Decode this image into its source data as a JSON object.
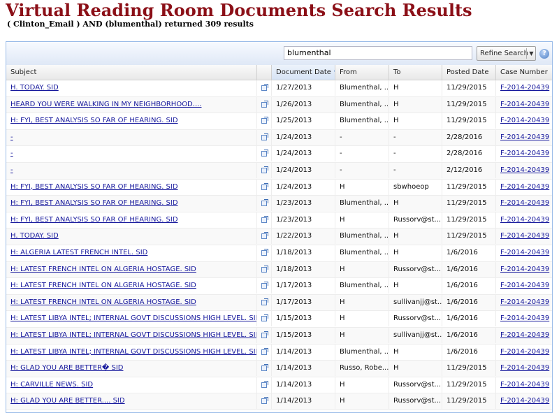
{
  "header": {
    "title": "Virtual Reading Room Documents Search Results",
    "summary": "( Clinton_Email ) AND (blumenthal) returned 309 results"
  },
  "toolbar": {
    "search_value": "blumenthal",
    "refine_label": "Refine Search",
    "dropdown_glyph": "▼",
    "help_glyph": "?"
  },
  "columns": {
    "subject": "Subject",
    "document_date": "Document Date",
    "sort_glyph": "▼",
    "from": "From",
    "to": "To",
    "posted_date": "Posted Date",
    "case_number": "Case Number"
  },
  "rows": [
    {
      "subject": "H. TODAY. SID",
      "date": "1/27/2013",
      "from": "Blumenthal, ...",
      "to": "H",
      "posted": "11/29/2015",
      "case": "F-2014-20439"
    },
    {
      "subject": "HEARD YOU WERE WALKING IN MY NEIGHBORHOOD....",
      "date": "1/26/2013",
      "from": "Blumenthal, ...",
      "to": "H",
      "posted": "11/29/2015",
      "case": "F-2014-20439"
    },
    {
      "subject": "H: FYI, BEST ANALYSIS SO FAR OF HEARING. SID",
      "date": "1/25/2013",
      "from": "Blumenthal, ...",
      "to": "H",
      "posted": "11/29/2015",
      "case": "F-2014-20439"
    },
    {
      "subject": "-",
      "date": "1/24/2013",
      "from": "-",
      "to": "-",
      "posted": "2/28/2016",
      "case": "F-2014-20439"
    },
    {
      "subject": "-",
      "date": "1/24/2013",
      "from": "-",
      "to": "-",
      "posted": "2/28/2016",
      "case": "F-2014-20439"
    },
    {
      "subject": "-",
      "date": "1/24/2013",
      "from": "-",
      "to": "-",
      "posted": "2/12/2016",
      "case": "F-2014-20439"
    },
    {
      "subject": "H: FYI, BEST ANALYSIS SO FAR OF HEARING. SID",
      "date": "1/24/2013",
      "from": "H",
      "to": "sbwhoeop",
      "posted": "11/29/2015",
      "case": "F-2014-20439"
    },
    {
      "subject": "H: FYI, BEST ANALYSIS SO FAR OF HEARING. SID",
      "date": "1/23/2013",
      "from": "Blumenthal, ...",
      "to": "H",
      "posted": "11/29/2015",
      "case": "F-2014-20439"
    },
    {
      "subject": "H: FYI, BEST ANALYSIS SO FAR OF HEARING. SID",
      "date": "1/23/2013",
      "from": "H",
      "to": "Russorv@st...",
      "posted": "11/29/2015",
      "case": "F-2014-20439"
    },
    {
      "subject": "H. TODAY. SID",
      "date": "1/22/2013",
      "from": "Blumenthal, ...",
      "to": "H",
      "posted": "11/29/2015",
      "case": "F-2014-20439"
    },
    {
      "subject": "H: ALGERIA LATEST FRENCH INTEL. SID",
      "date": "1/18/2013",
      "from": "Blumenthal, ...",
      "to": "H",
      "posted": "1/6/2016",
      "case": "F-2014-20439"
    },
    {
      "subject": "H: LATEST FRENCH INTEL ON ALGERIA HOSTAGE. SID",
      "date": "1/18/2013",
      "from": "H",
      "to": "Russorv@st...",
      "posted": "1/6/2016",
      "case": "F-2014-20439"
    },
    {
      "subject": "H: LATEST FRENCH INTEL ON ALGERIA HOSTAGE. SID",
      "date": "1/17/2013",
      "from": "Blumenthal, ...",
      "to": "H",
      "posted": "1/6/2016",
      "case": "F-2014-20439"
    },
    {
      "subject": "H: LATEST FRENCH INTEL ON ALGERIA HOSTAGE. SID",
      "date": "1/17/2013",
      "from": "H",
      "to": "sullivanjj@st...",
      "posted": "1/6/2016",
      "case": "F-2014-20439"
    },
    {
      "subject": "H: LATEST LIBYA INTEL; INTERNAL GOVT DISCUSSIONS HIGH LEVEL. SID",
      "date": "1/15/2013",
      "from": "H",
      "to": "Russorv@st...",
      "posted": "1/6/2016",
      "case": "F-2014-20439"
    },
    {
      "subject": "H: LATEST LIBYA INTEL; INTERNAL GOVT DISCUSSIONS HIGH LEVEL. SID",
      "date": "1/15/2013",
      "from": "H",
      "to": "sullivanjj@st...",
      "posted": "1/6/2016",
      "case": "F-2014-20439"
    },
    {
      "subject": "H: LATEST LIBYA INTEL; INTERNAL GOVT DISCUSSIONS HIGH LEVEL. SID",
      "date": "1/14/2013",
      "from": "Blumenthal, ...",
      "to": "H",
      "posted": "1/6/2016",
      "case": "F-2014-20439"
    },
    {
      "subject": "H: GLAD YOU ARE BETTER� SID",
      "date": "1/14/2013",
      "from": "Russo, Robe...",
      "to": "H",
      "posted": "11/29/2015",
      "case": "F-2014-20439"
    },
    {
      "subject": "H: CARVILLE NEWS. SID",
      "date": "1/14/2013",
      "from": "H",
      "to": "Russorv@st...",
      "posted": "11/29/2015",
      "case": "F-2014-20439"
    },
    {
      "subject": "H: GLAD YOU ARE BETTER.... SID",
      "date": "1/14/2013",
      "from": "H",
      "to": "Russorv@st...",
      "posted": "11/29/2015",
      "case": "F-2014-20439"
    }
  ]
}
